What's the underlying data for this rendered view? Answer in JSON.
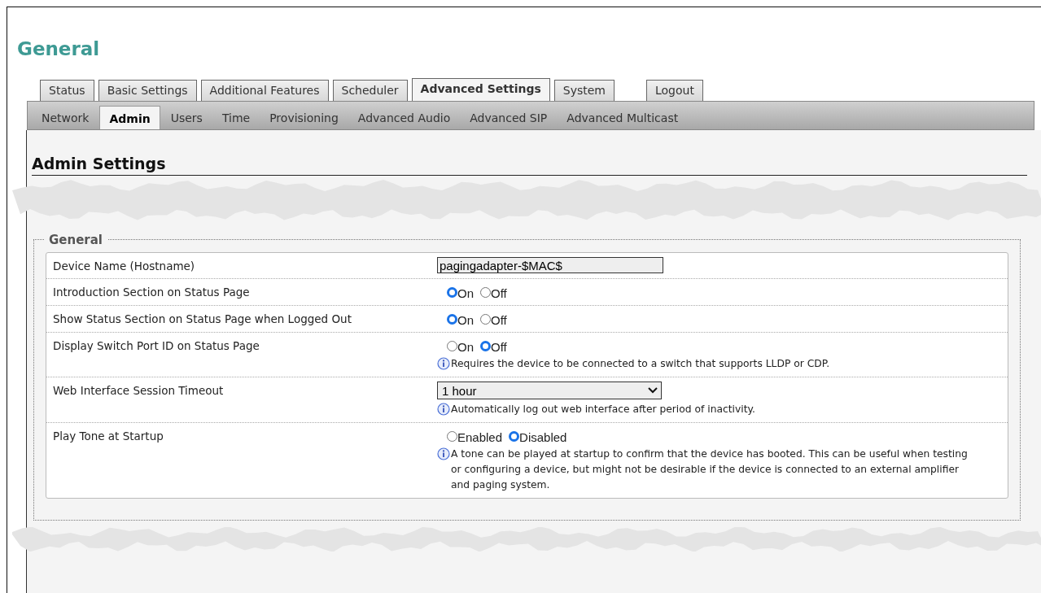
{
  "heading": "General",
  "tabs": [
    {
      "label": "Status",
      "selected": false
    },
    {
      "label": "Basic Settings",
      "selected": false
    },
    {
      "label": "Additional Features",
      "selected": false
    },
    {
      "label": "Scheduler",
      "selected": false
    },
    {
      "label": "Advanced Settings",
      "selected": true
    },
    {
      "label": "System",
      "selected": false
    },
    {
      "label": "Logout",
      "selected": false,
      "kind": "apart"
    }
  ],
  "subtabs": [
    {
      "label": "Network",
      "selected": false
    },
    {
      "label": "Admin",
      "selected": true
    },
    {
      "label": "Users",
      "selected": false
    },
    {
      "label": "Time",
      "selected": false
    },
    {
      "label": "Provisioning",
      "selected": false
    },
    {
      "label": "Advanced Audio",
      "selected": false
    },
    {
      "label": "Advanced SIP",
      "selected": false
    },
    {
      "label": "Advanced Multicast",
      "selected": false
    }
  ],
  "page_title": "Admin Settings",
  "fieldset": {
    "legend": "General",
    "rows": [
      {
        "kind": "text",
        "label": "Device Name (Hostname)",
        "value": "pagingadapter-$MAC$"
      },
      {
        "kind": "radio",
        "label": "Introduction Section on Status Page",
        "options": [
          {
            "label": "On",
            "selected": true
          },
          {
            "label": "Off",
            "selected": false
          }
        ]
      },
      {
        "kind": "radio",
        "label": "Show Status Section on Status Page when Logged Out",
        "options": [
          {
            "label": "On",
            "selected": true
          },
          {
            "label": "Off",
            "selected": false
          }
        ]
      },
      {
        "kind": "radio",
        "label": "Display Switch Port ID on Status Page",
        "options": [
          {
            "label": "On",
            "selected": false
          },
          {
            "label": "Off",
            "selected": true
          }
        ],
        "hint": "Requires the device to be connected to a switch that supports LLDP or CDP."
      },
      {
        "kind": "select",
        "label": "Web Interface Session Timeout",
        "value": "1 hour",
        "hint": "Automatically log out web interface after period of inactivity."
      },
      {
        "kind": "radio",
        "label": "Play Tone at Startup",
        "options": [
          {
            "label": "Enabled",
            "selected": false
          },
          {
            "label": "Disabled",
            "selected": true
          }
        ],
        "hint": "A tone can be played at startup to confirm that the device has booted. This can be useful when testing or configuring a device, but might not be desirable if the device is connected to an external amplifier and paging system."
      }
    ]
  }
}
